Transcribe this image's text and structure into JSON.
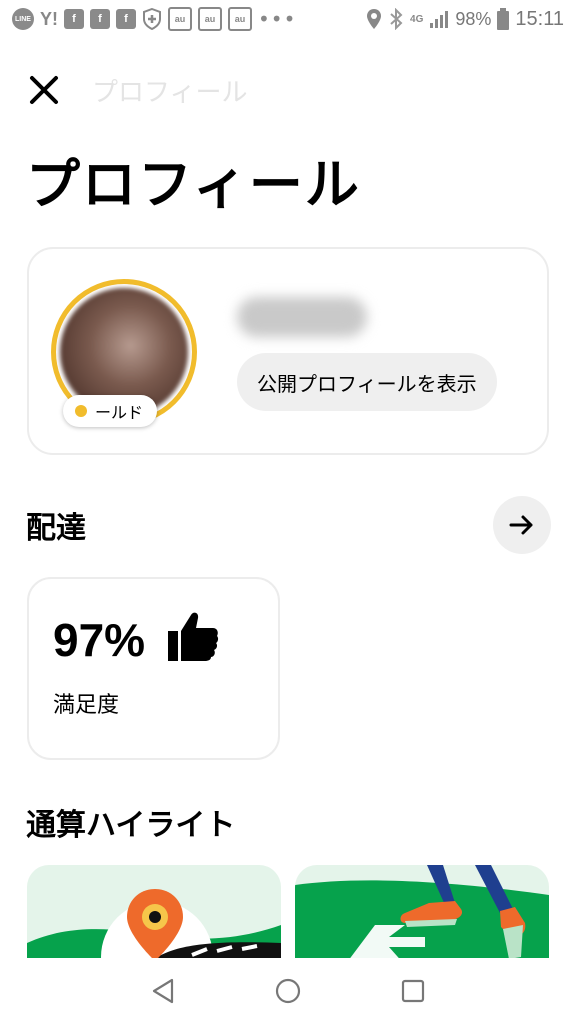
{
  "status_bar": {
    "left_icons": [
      "line-icon",
      "yahoo-icon",
      "facebook-icon",
      "facebook-icon",
      "facebook-icon",
      "shield-cross-icon",
      "au-icon",
      "au-icon",
      "au-icon"
    ],
    "left_labels": {
      "line": "LINE",
      "yahoo": "Y!",
      "fb": "f",
      "au": "au"
    },
    "more": "•••",
    "network": "4G",
    "battery": "98%",
    "time": "15:11"
  },
  "header": {
    "faint_title": "プロフィール",
    "title": "プロフィール"
  },
  "profile": {
    "tier": "ールド",
    "public_profile_button": "公開プロフィールを表示"
  },
  "delivery": {
    "title": "配達",
    "satisfaction_value": "97%",
    "satisfaction_label": "満足度"
  },
  "highlights": {
    "title": "通算ハイライト"
  },
  "colors": {
    "gold": "#f1bc2c",
    "uber_green": "#06a24c",
    "pin_orange": "#ee6a2b",
    "card_border": "#ececec",
    "button_bg": "#efefef"
  }
}
